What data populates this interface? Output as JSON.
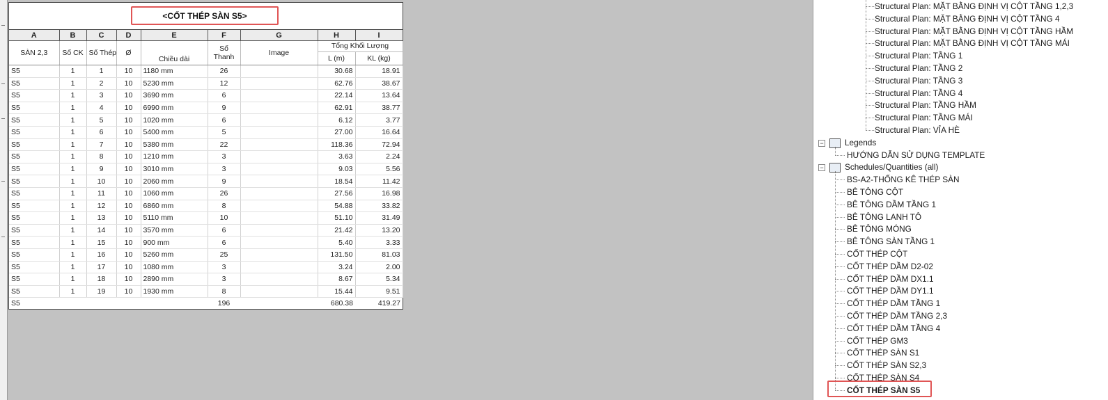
{
  "schedule": {
    "title": "<CỐT THÉP SÀN S5>",
    "column_letters": [
      "A",
      "B",
      "C",
      "D",
      "E",
      "F",
      "G",
      "H",
      "I"
    ],
    "headers": {
      "a": "SÀN 2,3",
      "b": "Số CK",
      "c": "Số Thép",
      "d": "Ø",
      "e": "Chiều dài",
      "f": "Số Thanh",
      "g": "Image",
      "group": "Tổng Khối Lượng",
      "h": "L (m)",
      "i": "KL (kg)"
    },
    "rows": [
      {
        "a": "S5",
        "b": "1",
        "c": "1",
        "d": "10",
        "e": "1180 mm",
        "f": "26",
        "g": "",
        "h": "30.68",
        "i": "18.91"
      },
      {
        "a": "S5",
        "b": "1",
        "c": "2",
        "d": "10",
        "e": "5230 mm",
        "f": "12",
        "g": "",
        "h": "62.76",
        "i": "38.67"
      },
      {
        "a": "S5",
        "b": "1",
        "c": "3",
        "d": "10",
        "e": "3690 mm",
        "f": "6",
        "g": "",
        "h": "22.14",
        "i": "13.64"
      },
      {
        "a": "S5",
        "b": "1",
        "c": "4",
        "d": "10",
        "e": "6990 mm",
        "f": "9",
        "g": "",
        "h": "62.91",
        "i": "38.77"
      },
      {
        "a": "S5",
        "b": "1",
        "c": "5",
        "d": "10",
        "e": "1020 mm",
        "f": "6",
        "g": "",
        "h": "6.12",
        "i": "3.77"
      },
      {
        "a": "S5",
        "b": "1",
        "c": "6",
        "d": "10",
        "e": "5400 mm",
        "f": "5",
        "g": "",
        "h": "27.00",
        "i": "16.64"
      },
      {
        "a": "S5",
        "b": "1",
        "c": "7",
        "d": "10",
        "e": "5380 mm",
        "f": "22",
        "g": "",
        "h": "118.36",
        "i": "72.94"
      },
      {
        "a": "S5",
        "b": "1",
        "c": "8",
        "d": "10",
        "e": "1210 mm",
        "f": "3",
        "g": "",
        "h": "3.63",
        "i": "2.24"
      },
      {
        "a": "S5",
        "b": "1",
        "c": "9",
        "d": "10",
        "e": "3010 mm",
        "f": "3",
        "g": "",
        "h": "9.03",
        "i": "5.56"
      },
      {
        "a": "S5",
        "b": "1",
        "c": "10",
        "d": "10",
        "e": "2060 mm",
        "f": "9",
        "g": "",
        "h": "18.54",
        "i": "11.42"
      },
      {
        "a": "S5",
        "b": "1",
        "c": "11",
        "d": "10",
        "e": "1060 mm",
        "f": "26",
        "g": "",
        "h": "27.56",
        "i": "16.98"
      },
      {
        "a": "S5",
        "b": "1",
        "c": "12",
        "d": "10",
        "e": "6860 mm",
        "f": "8",
        "g": "",
        "h": "54.88",
        "i": "33.82"
      },
      {
        "a": "S5",
        "b": "1",
        "c": "13",
        "d": "10",
        "e": "5110 mm",
        "f": "10",
        "g": "",
        "h": "51.10",
        "i": "31.49"
      },
      {
        "a": "S5",
        "b": "1",
        "c": "14",
        "d": "10",
        "e": "3570 mm",
        "f": "6",
        "g": "",
        "h": "21.42",
        "i": "13.20"
      },
      {
        "a": "S5",
        "b": "1",
        "c": "15",
        "d": "10",
        "e": "900 mm",
        "f": "6",
        "g": "",
        "h": "5.40",
        "i": "3.33"
      },
      {
        "a": "S5",
        "b": "1",
        "c": "16",
        "d": "10",
        "e": "5260 mm",
        "f": "25",
        "g": "",
        "h": "131.50",
        "i": "81.03"
      },
      {
        "a": "S5",
        "b": "1",
        "c": "17",
        "d": "10",
        "e": "1080 mm",
        "f": "3",
        "g": "",
        "h": "3.24",
        "i": "2.00"
      },
      {
        "a": "S5",
        "b": "1",
        "c": "18",
        "d": "10",
        "e": "2890 mm",
        "f": "3",
        "g": "",
        "h": "8.67",
        "i": "5.34"
      },
      {
        "a": "S5",
        "b": "1",
        "c": "19",
        "d": "10",
        "e": "1930 mm",
        "f": "8",
        "g": "",
        "h": "15.44",
        "i": "9.51"
      }
    ],
    "total": {
      "a": "S5",
      "f": "196",
      "h": "680.38",
      "i": "419.27"
    }
  },
  "browser": {
    "structural_plans": [
      "Structural Plan: MẶT BẰNG ĐỊNH VỊ CỘT TẦNG 1,2,3",
      "Structural Plan: MẶT BẰNG ĐỊNH VỊ CỘT TẦNG 4",
      "Structural Plan: MẶT BẰNG ĐỊNH VỊ CỘT TẦNG HẦM",
      "Structural Plan: MẶT BẰNG ĐỊNH VỊ CỘT TẦNG MÁI",
      "Structural Plan: TẦNG 1",
      "Structural Plan: TẦNG 2",
      "Structural Plan: TẦNG 3",
      "Structural Plan: TẦNG 4",
      "Structural Plan: TẦNG HẦM",
      "Structural Plan: TẦNG MÁI",
      "Structural Plan: VỈA HÈ"
    ],
    "legends_label": "Legends",
    "legends_items": [
      "HƯỚNG DẪN SỬ DỤNG TEMPLATE"
    ],
    "schedules_label": "Schedules/Quantities (all)",
    "schedules_items": [
      "BS-A2-THỐNG KÊ THÉP SÀN",
      "BÊ TÔNG CỘT",
      "BÊ TÔNG DẦM TẦNG 1",
      "BÊ TÔNG LANH TÔ",
      "BÊ TÔNG MÓNG",
      "BÊ TÔNG SÀN TẦNG 1",
      "CỐT THÉP CỘT",
      "CỐT THÉP DẦM D2-02",
      "CỐT THÉP DẦM DX1.1",
      "CỐT THÉP DẦM DY1.1",
      "CỐT THÉP DẦM TẦNG 1",
      "CỐT THÉP DẦM TẦNG 2,3",
      "CỐT THÉP DẦM TẦNG 4",
      "CỐT THÉP GM3",
      "CỐT THÉP SÀN S1",
      "CỐT THÉP SÀN S2,3",
      "CỐT THÉP SÀN S4",
      "CỐT THÉP SÀN S5"
    ],
    "selected_item": "CỐT THÉP SÀN S5",
    "toggle_symbol": "−",
    "icons": {
      "legends": "legend-icon",
      "schedules": "schedule-icon"
    },
    "accent_color": "#e05555"
  }
}
